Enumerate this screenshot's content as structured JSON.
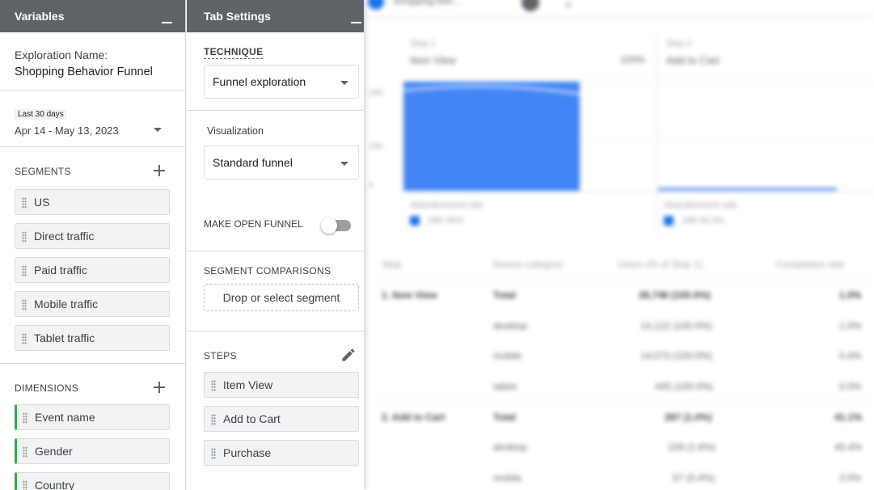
{
  "variables_panel": {
    "title": "Variables",
    "exploration_label": "Exploration Name:",
    "exploration_name": "Shopping Behavior Funnel",
    "date_badge": "Last 30 days",
    "date_range": "Apr 14 - May 13, 2023",
    "segments_title": "SEGMENTS",
    "segments": [
      "US",
      "Direct traffic",
      "Paid traffic",
      "Mobile traffic",
      "Tablet traffic"
    ],
    "dimensions_title": "DIMENSIONS",
    "dimensions": [
      "Event name",
      "Gender",
      "Country"
    ]
  },
  "tab_settings": {
    "title": "Tab Settings",
    "technique_title": "TECHNIQUE",
    "technique_value": "Funnel exploration",
    "visualization_label": "Visualization",
    "visualization_value": "Standard funnel",
    "open_funnel_label": "MAKE OPEN FUNNEL",
    "open_funnel_on": false,
    "segment_comparisons_title": "SEGMENT COMPARISONS",
    "segment_drop_text": "Drop or select segment",
    "steps_title": "STEPS",
    "steps": [
      "Item View",
      "Add to Cart",
      "Purchase"
    ]
  },
  "colors": {
    "header_bg": "#5f6368",
    "funnel_blue": "#4285f4",
    "dimension_accent": "#34a853"
  }
}
